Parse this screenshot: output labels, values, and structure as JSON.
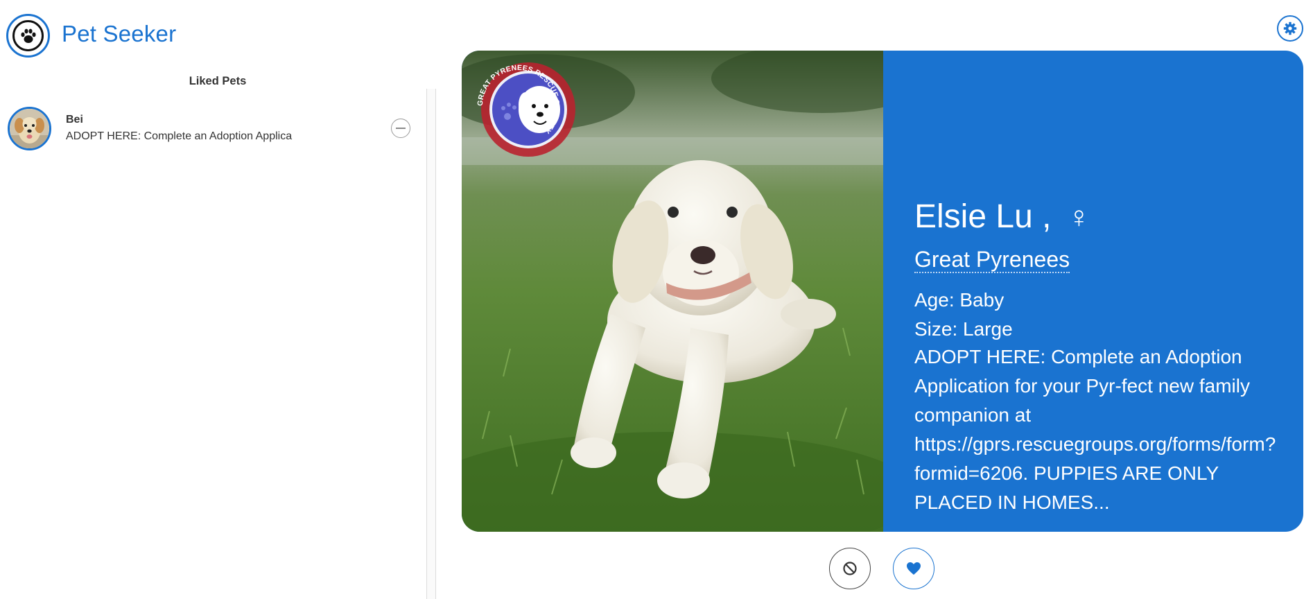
{
  "header": {
    "app_title": "Pet Seeker",
    "logo_icon": "paw-icon",
    "settings_icon": "gear-icon"
  },
  "sidebar": {
    "heading": "Liked Pets",
    "items": [
      {
        "name": "Bei",
        "description": "ADOPT HERE: Complete an Adoption Applica",
        "remove_icon": "minus-circle-icon"
      }
    ]
  },
  "card": {
    "name": "Elsie Lu ,",
    "gender_symbol": "♀",
    "breed": "Great Pyrenees",
    "age": "Age: Baby",
    "size": "Size: Large",
    "description": "ADOPT HERE: Complete an Adoption Application for your Pyr-fect new family companion at https://gprs.rescuegroups.org/forms/form?formid=6206. PUPPIES ARE ONLY PLACED IN HOMES...",
    "watermark_text": "GREAT PYRENEES RESCUE SOCIETY"
  },
  "actions": {
    "pass_icon": "ban-icon",
    "like_icon": "heart-icon"
  },
  "colors": {
    "accent": "#1a73d0",
    "card_background": "#1a73d0"
  }
}
